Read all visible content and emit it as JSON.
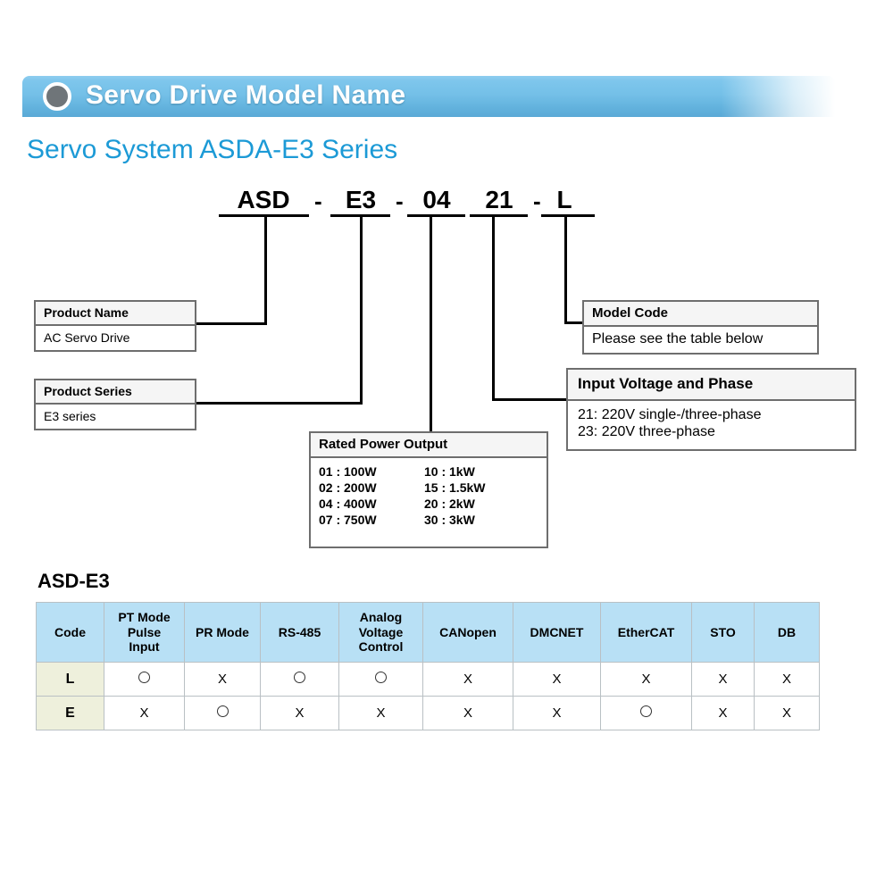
{
  "header": {
    "title": "Servo Drive Model Name",
    "bullet_icon": "filled-circle-icon"
  },
  "sub_heading": "Servo System ASDA-E3 Series",
  "model_name": {
    "tokens": [
      {
        "text": "ASD"
      },
      {
        "text": "E3"
      },
      {
        "text": "04"
      },
      {
        "text": "21"
      },
      {
        "text": "L"
      }
    ],
    "separators": [
      "-",
      "-",
      "-"
    ]
  },
  "callouts": {
    "product_name": {
      "title": "Product Name",
      "body": [
        "AC Servo Drive"
      ]
    },
    "product_series": {
      "title": "Product Series",
      "body": [
        "E3 series"
      ]
    },
    "rated_power": {
      "title": "Rated Power Output",
      "entries": [
        {
          "left": "01 : 100W",
          "right": "10 : 1kW"
        },
        {
          "left": "02 : 200W",
          "right": "15 : 1.5kW"
        },
        {
          "left": "04 : 400W",
          "right": "20 : 2kW"
        },
        {
          "left": "07 : 750W",
          "right": "30 : 3kW"
        }
      ]
    },
    "model_code": {
      "title": "Model Code",
      "body": [
        "Please see the table below"
      ]
    },
    "input_voltage": {
      "title": "Input Voltage and Phase",
      "body": [
        "21: 220V single-/three-phase",
        "23: 220V three-phase"
      ]
    }
  },
  "table": {
    "label": "ASD-E3",
    "columns": [
      "Code",
      "PT Mode\nPulse\nInput",
      "PR Mode",
      "RS-485",
      "Analog\nVoltage\nControl",
      "CANopen",
      "DMCNET",
      "EtherCAT",
      "STO",
      "DB"
    ],
    "rows": [
      {
        "code": "L",
        "marks": [
          "O",
          "X",
          "O",
          "O",
          "X",
          "X",
          "X",
          "X",
          "X"
        ]
      },
      {
        "code": "E",
        "marks": [
          "X",
          "O",
          "X",
          "X",
          "X",
          "X",
          "O",
          "X",
          "X"
        ]
      }
    ],
    "mark_legend": {
      "O": "supported-circle",
      "X": "not-supported-cross"
    }
  },
  "colors": {
    "banner_blue": "#74c0e8",
    "heading_blue": "#1c9ad6",
    "table_header_blue": "#b8e0f5",
    "code_column": "#eef0dc"
  }
}
